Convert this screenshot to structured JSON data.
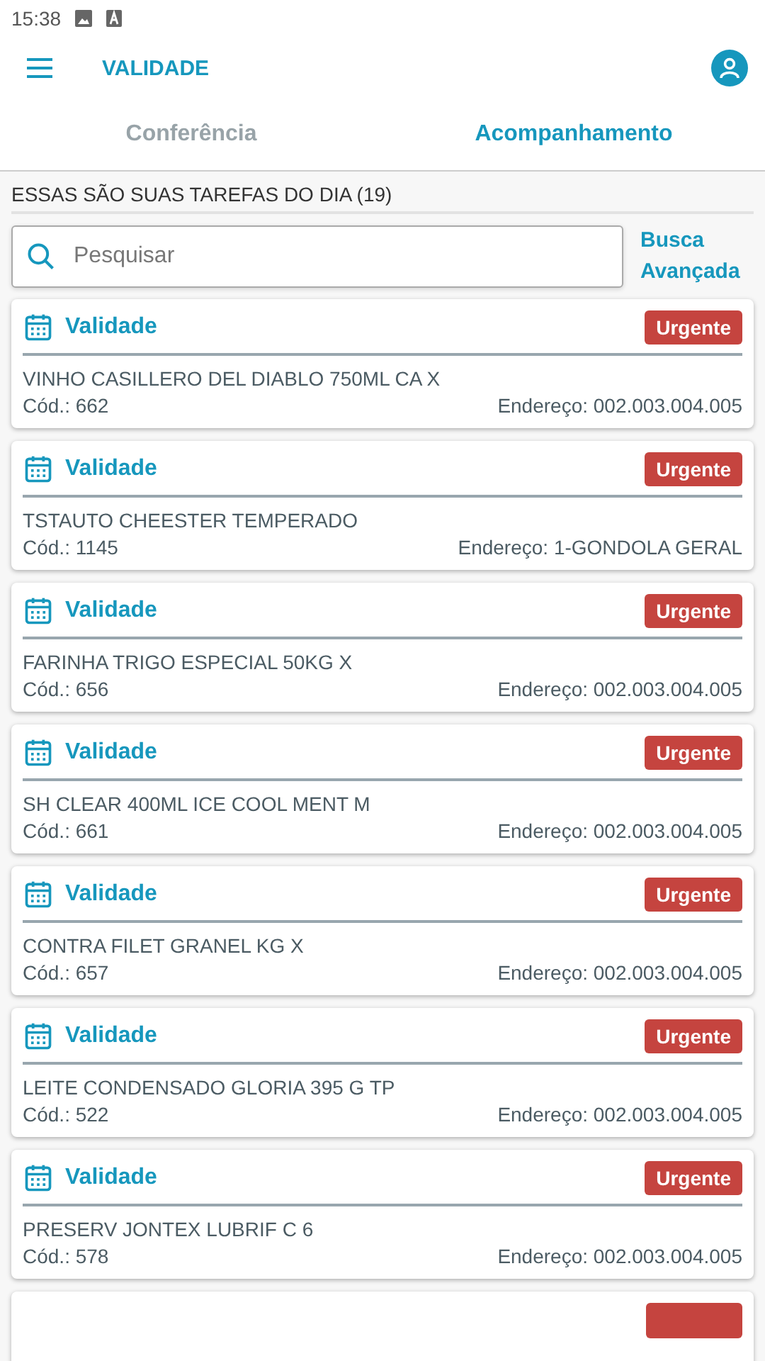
{
  "status_bar": {
    "time": "15:38"
  },
  "app_bar": {
    "title": "VALIDADE"
  },
  "tabs": [
    {
      "label": "Conferência",
      "selected": false
    },
    {
      "label": "Acompanhamento",
      "selected": true
    }
  ],
  "tasks_header": "ESSAS SÃO SUAS TAREFAS DO DIA (19)",
  "search": {
    "placeholder": "Pesquisar"
  },
  "advanced_search": "Busca Avançada",
  "tasks": [
    {
      "type": "Validade",
      "badge": "Urgente",
      "product": "VINHO CASILLERO DEL DIABLO 750ML CA X",
      "code": "Cód.: 662",
      "address": "Endereço: 002.003.004.005"
    },
    {
      "type": "Validade",
      "badge": "Urgente",
      "product": "TSTAUTO CHEESTER TEMPERADO",
      "code": "Cód.: 1145",
      "address": "Endereço: 1-GONDOLA GERAL"
    },
    {
      "type": "Validade",
      "badge": "Urgente",
      "product": "FARINHA TRIGO ESPECIAL 50KG X",
      "code": "Cód.: 656",
      "address": "Endereço: 002.003.004.005"
    },
    {
      "type": "Validade",
      "badge": "Urgente",
      "product": "SH CLEAR 400ML ICE COOL MENT M",
      "code": "Cód.: 661",
      "address": "Endereço: 002.003.004.005"
    },
    {
      "type": "Validade",
      "badge": "Urgente",
      "product": "CONTRA FILET GRANEL KG X",
      "code": "Cód.: 657",
      "address": "Endereço: 002.003.004.005"
    },
    {
      "type": "Validade",
      "badge": "Urgente",
      "product": "LEITE CONDENSADO GLORIA 395 G TP",
      "code": "Cód.: 522",
      "address": "Endereço: 002.003.004.005"
    },
    {
      "type": "Validade",
      "badge": "Urgente",
      "product": "PRESERV JONTEX LUBRIF C 6",
      "code": "Cód.: 578",
      "address": "Endereço: 002.003.004.005"
    }
  ]
}
